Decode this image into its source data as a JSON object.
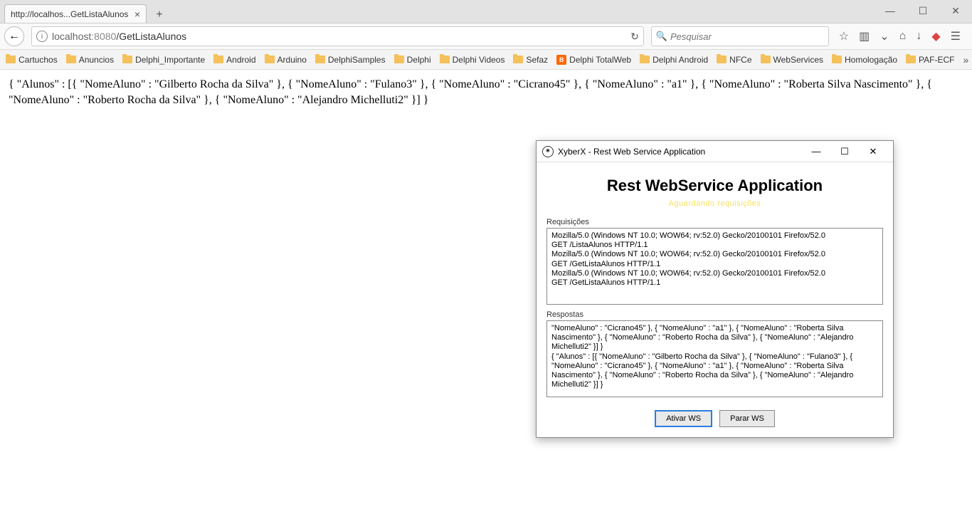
{
  "browser": {
    "tab_title": "http://localhos...GetListaAlunos",
    "url_host": "localhost",
    "url_port": ":8080",
    "url_path": "/GetListaAlunos",
    "search_placeholder": "Pesquisar",
    "bookmarks": [
      {
        "label": "Cartuchos",
        "type": "folder"
      },
      {
        "label": "Anuncios",
        "type": "folder"
      },
      {
        "label": "Delphi_Importante",
        "type": "folder"
      },
      {
        "label": "Android",
        "type": "folder"
      },
      {
        "label": "Arduino",
        "type": "folder"
      },
      {
        "label": "DelphiSamples",
        "type": "folder"
      },
      {
        "label": "Delphi",
        "type": "folder"
      },
      {
        "label": "Delphi Videos",
        "type": "folder"
      },
      {
        "label": "Sefaz",
        "type": "folder"
      },
      {
        "label": "Delphi TotalWeb",
        "type": "blogger"
      },
      {
        "label": "Delphi Android",
        "type": "folder"
      },
      {
        "label": "NFCe",
        "type": "folder"
      },
      {
        "label": "WebServices",
        "type": "folder"
      },
      {
        "label": "Homologação",
        "type": "folder"
      },
      {
        "label": "PAF-ECF",
        "type": "folder"
      }
    ]
  },
  "page_text": "{ \"Alunos\" : [{ \"NomeAluno\" : \"Gilberto Rocha da Silva\" }, { \"NomeAluno\" : \"Fulano3\" }, { \"NomeAluno\" : \"Cicrano45\" }, { \"NomeAluno\" : \"a1\" }, { \"NomeAluno\" : \"Roberta Silva Nascimento\" }, { \"NomeAluno\" : \"Roberto Rocha da Silva\" }, { \"NomeAluno\" : \"Alejandro Michelluti2\" }] }",
  "app": {
    "window_title": "XyberX - Rest Web Service Application",
    "heading": "Rest WebService Application",
    "subheading": "Aguardando requisições",
    "req_label": "Requisições",
    "resp_label": "Respostas",
    "req_log": "Mozilla/5.0 (Windows NT 10.0; WOW64; rv:52.0) Gecko/20100101 Firefox/52.0\nGET /ListaAlunos HTTP/1.1\nMozilla/5.0 (Windows NT 10.0; WOW64; rv:52.0) Gecko/20100101 Firefox/52.0\nGET /GetListaAlunos HTTP/1.1\nMozilla/5.0 (Windows NT 10.0; WOW64; rv:52.0) Gecko/20100101 Firefox/52.0\nGET /GetListaAlunos HTTP/1.1",
    "resp_log": "\"NomeAluno\" : \"Cicrano45\" }, { \"NomeAluno\" : \"a1\" }, { \"NomeAluno\" : \"Roberta Silva Nascimento\" }, { \"NomeAluno\" : \"Roberto Rocha da Silva\" }, { \"NomeAluno\" : \"Alejandro Michelluti2\" }] }\n{ \"Alunos\" : [{ \"NomeAluno\" : \"Gilberto Rocha da Silva\" }, { \"NomeAluno\" : \"Fulano3\" }, { \"NomeAluno\" : \"Cicrano45\" }, { \"NomeAluno\" : \"a1\" }, { \"NomeAluno\" : \"Roberta Silva Nascimento\" }, { \"NomeAluno\" : \"Roberto Rocha da Silva\" }, { \"NomeAluno\" : \"Alejandro Michelluti2\" }] }",
    "btn_activate": "Ativar WS",
    "btn_stop": "Parar WS"
  }
}
